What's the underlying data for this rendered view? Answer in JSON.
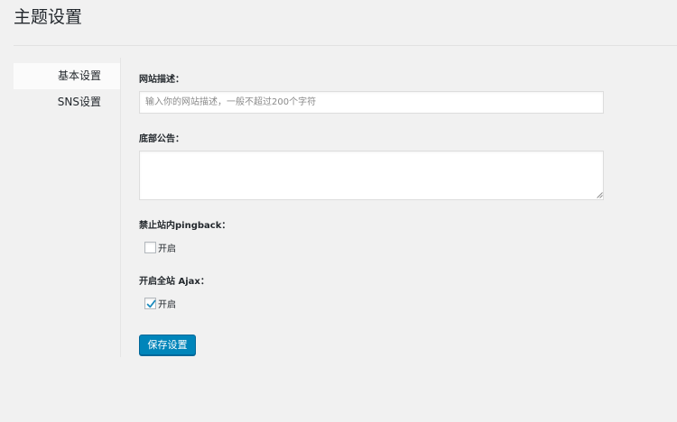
{
  "page": {
    "title": "主题设置"
  },
  "sidebar": {
    "items": [
      {
        "label": "基本设置",
        "active": true
      },
      {
        "label": "SNS设置",
        "active": false
      }
    ]
  },
  "form": {
    "site_description": {
      "label": "网站描述：",
      "value": "",
      "placeholder": "输入你的网站描述，一般不超过200个字符"
    },
    "footer_notice": {
      "label": "底部公告：",
      "value": ""
    },
    "disable_pingback": {
      "label": "禁止站内pingback：",
      "option_label": "开启",
      "checked": false
    },
    "enable_ajax": {
      "label": "开启全站 Ajax：",
      "option_label": "开启",
      "checked": true
    },
    "save_label": "保存设置"
  },
  "colors": {
    "primary_button": "#0085ba",
    "checkmark": "#1e8cbe",
    "background": "#f1f1f1"
  },
  "icons": {
    "checkmark": "checkmark-icon",
    "resize": "resize-handle-icon"
  }
}
